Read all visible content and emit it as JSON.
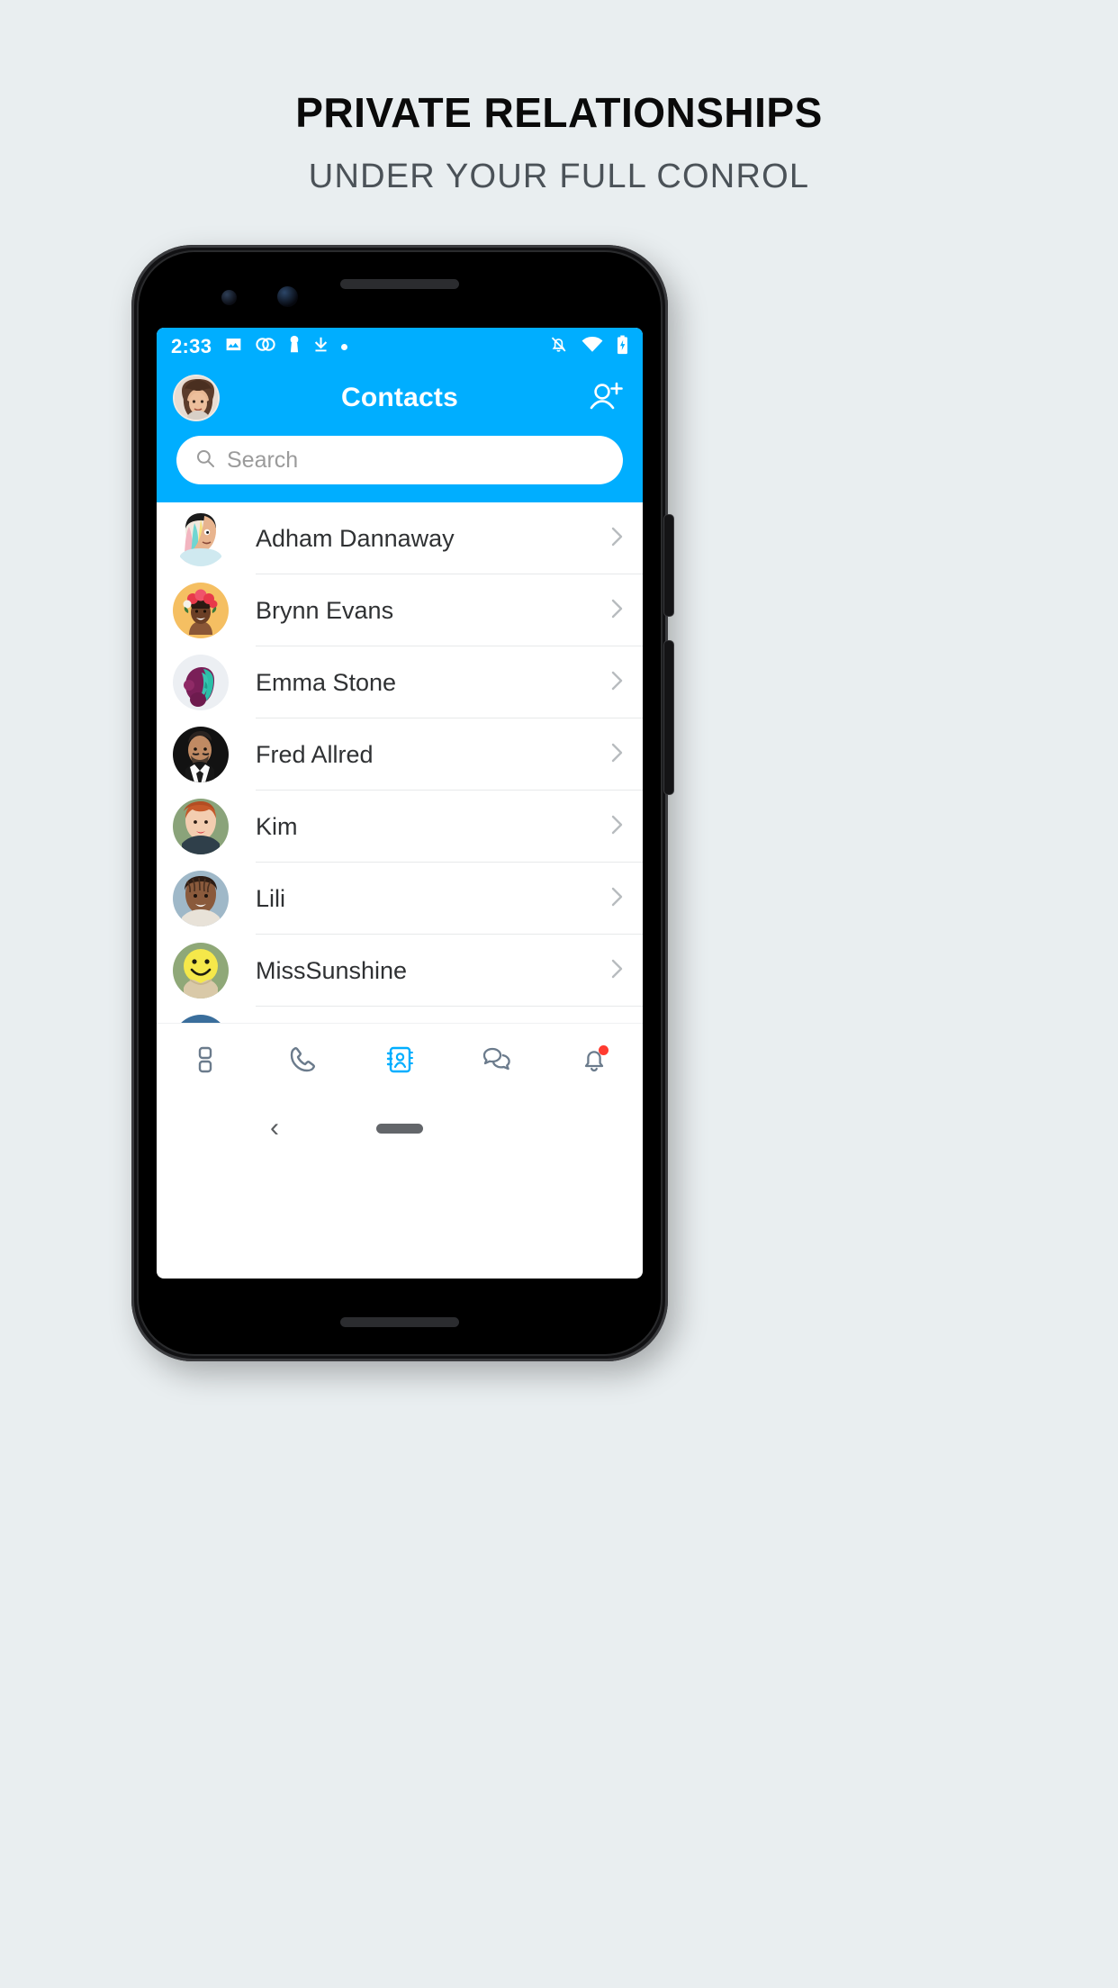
{
  "marketing": {
    "headline": "PRIVATE RELATIONSHIPS",
    "subheadline": "UNDER YOUR FULL CONROL"
  },
  "colors": {
    "brand_blue": "#00aeff",
    "page_background": "#e9eef0",
    "text_dark": "#2f3133",
    "notification_red": "#ff3b30"
  },
  "status_bar": {
    "time": "2:33",
    "left_icons": [
      "image-icon",
      "overlapping-circles-icon",
      "person-icon",
      "download-icon",
      "dot-icon"
    ],
    "right_icons": [
      "bell-off-icon",
      "wifi-icon",
      "battery-charging-icon"
    ]
  },
  "app_bar": {
    "title": "Contacts",
    "avatar_name": "user-avatar",
    "action_icon": "add-person-icon"
  },
  "search": {
    "placeholder": "Search",
    "value": "",
    "icon": "search-icon"
  },
  "contacts": [
    {
      "name": "Adham Dannaway",
      "chevron": "chevron-right-icon"
    },
    {
      "name": "Brynn Evans",
      "chevron": "chevron-right-icon"
    },
    {
      "name": "Emma Stone",
      "chevron": "chevron-right-icon"
    },
    {
      "name": "Fred Allred",
      "chevron": "chevron-right-icon"
    },
    {
      "name": "Kim",
      "chevron": "chevron-right-icon"
    },
    {
      "name": "Lili",
      "chevron": "chevron-right-icon"
    },
    {
      "name": "MissSunshine",
      "chevron": "chevron-right-icon"
    }
  ],
  "tab_bar": {
    "items": [
      {
        "icon": "dashboard-icon",
        "active": false
      },
      {
        "icon": "phone-icon",
        "active": false
      },
      {
        "icon": "contacts-book-icon",
        "active": true
      },
      {
        "icon": "chat-bubbles-icon",
        "active": false
      },
      {
        "icon": "bell-icon",
        "active": false,
        "badge": true
      }
    ]
  },
  "system_nav": {
    "back_glyph": "‹",
    "home_pill": "home-pill"
  }
}
